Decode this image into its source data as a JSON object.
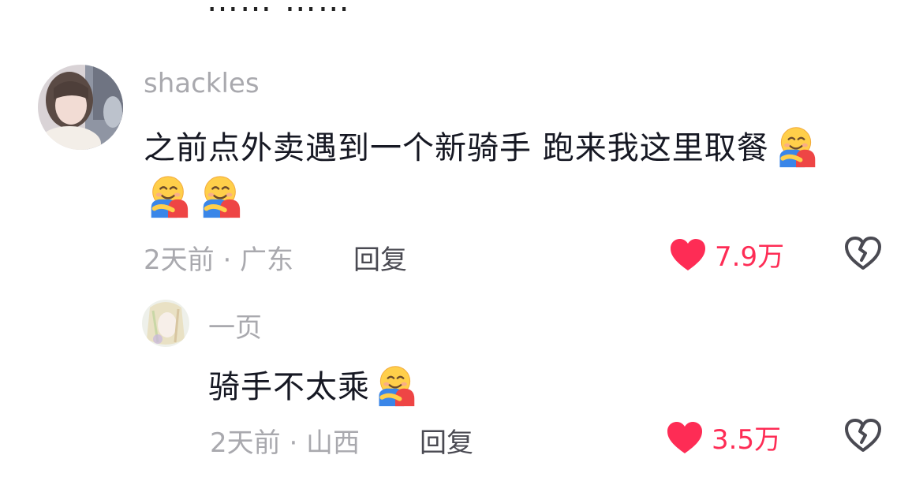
{
  "top_cut_text": "…… ……",
  "comments": [
    {
      "username": "shackles",
      "line1": "之前点外卖遇到一个新骑手 跑来我这里取餐",
      "meta": "2天前 · 广东",
      "reply_label": "回复",
      "likes": "7.9万",
      "liked": true
    },
    {
      "username": "一页",
      "line1": "骑手不太乘",
      "meta": "2天前 · 山西",
      "reply_label": "回复",
      "likes": "3.5万",
      "liked": true
    }
  ],
  "icons": {
    "like": "heart-icon",
    "dislike": "broken-heart-icon",
    "emoji": "hugging-face-emoji"
  },
  "colors": {
    "like_active": "#fe2c55",
    "meta_text": "#a9a9ae",
    "body_text": "#161823",
    "icon_gray": "#4a4a52"
  }
}
